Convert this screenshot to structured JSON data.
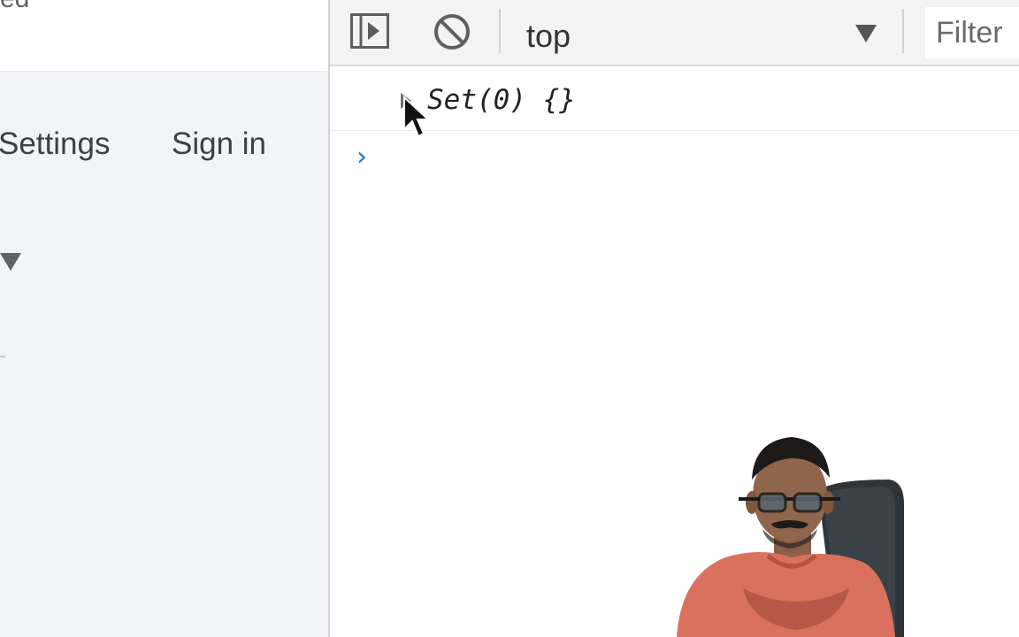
{
  "left_page": {
    "cutoff_heading": "ed",
    "settings_link": "Settings",
    "sign_in_link": "Sign in"
  },
  "devtools": {
    "toolbar": {
      "sidebar_toggle_icon": "sidebar-toggle-icon",
      "clear_icon": "clear-console-icon",
      "context_selected": "top",
      "filter_placeholder": "Filter"
    },
    "console": {
      "log_entries": [
        {
          "text": "Set(0) {}",
          "expandable": true
        }
      ],
      "prompt_symbol": "›"
    }
  },
  "colors": {
    "left_page_bg": "#f1f3f6",
    "toolbar_bg": "#f3f3f3",
    "prompt_accent": "#1a73e8",
    "shirt": "#d9715e"
  }
}
